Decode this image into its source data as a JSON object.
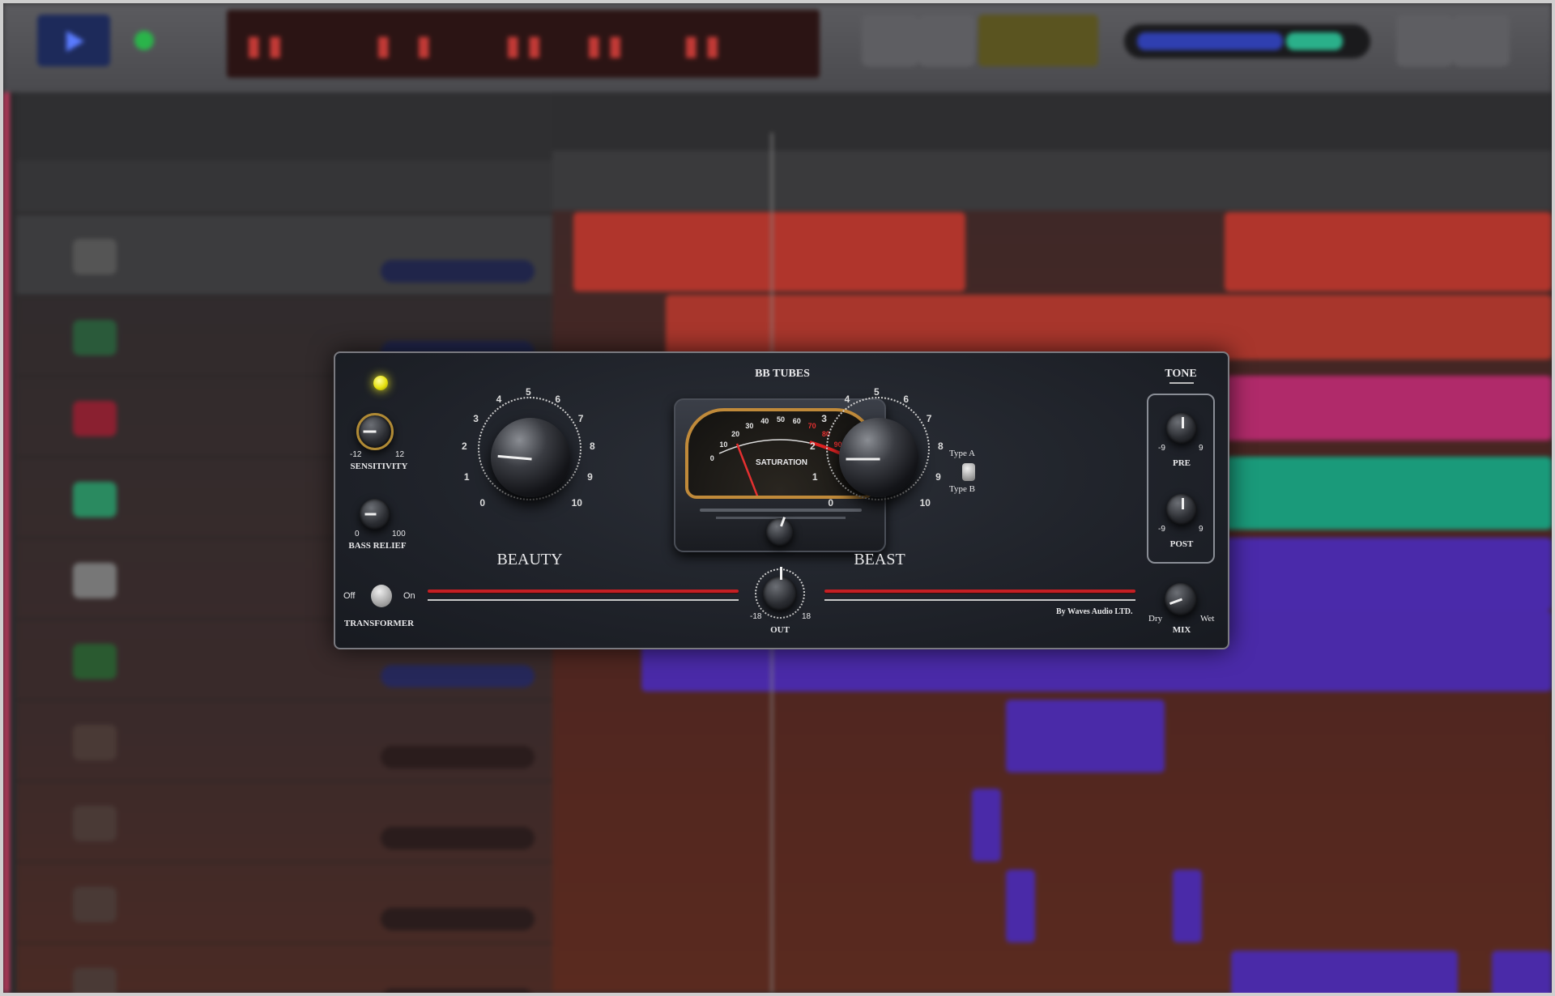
{
  "plugin": {
    "title": "BB TUBES",
    "tone_label": "TONE",
    "sensitivity": {
      "label": "SENSITIVITY",
      "min": "-12",
      "max": "12"
    },
    "bass_relief": {
      "label": "BASS RELIEF",
      "min": "0",
      "max": "100"
    },
    "beauty": {
      "label": "BEAUTY",
      "scale": [
        "0",
        "1",
        "2",
        "3",
        "4",
        "5",
        "6",
        "7",
        "8",
        "9",
        "10"
      ]
    },
    "beast": {
      "label": "BEAST",
      "scale": [
        "0",
        "1",
        "2",
        "3",
        "4",
        "5",
        "6",
        "7",
        "8",
        "9",
        "10"
      ]
    },
    "meter": {
      "label": "SATURATION",
      "scale": [
        "0",
        "10",
        "20",
        "30",
        "40",
        "50",
        "60",
        "70",
        "80",
        "90",
        "100"
      ]
    },
    "type_a": "Type A",
    "type_b": "Type B",
    "pre": {
      "label": "PRE",
      "min": "-9",
      "max": "9"
    },
    "post": {
      "label": "POST",
      "min": "-9",
      "max": "9"
    },
    "transformer": {
      "label": "TRANSFORMER",
      "off": "Off",
      "on": "On"
    },
    "out": {
      "label": "OUT",
      "min": "-18",
      "max": "18"
    },
    "mix": {
      "label": "MIX",
      "min": "Dry",
      "max": "Wet"
    },
    "credit": "By Waves Audio LTD.",
    "colors": {
      "led": "#f2ee20",
      "redline": "#c41f24",
      "meter_bezel": "#c08a3a"
    }
  }
}
